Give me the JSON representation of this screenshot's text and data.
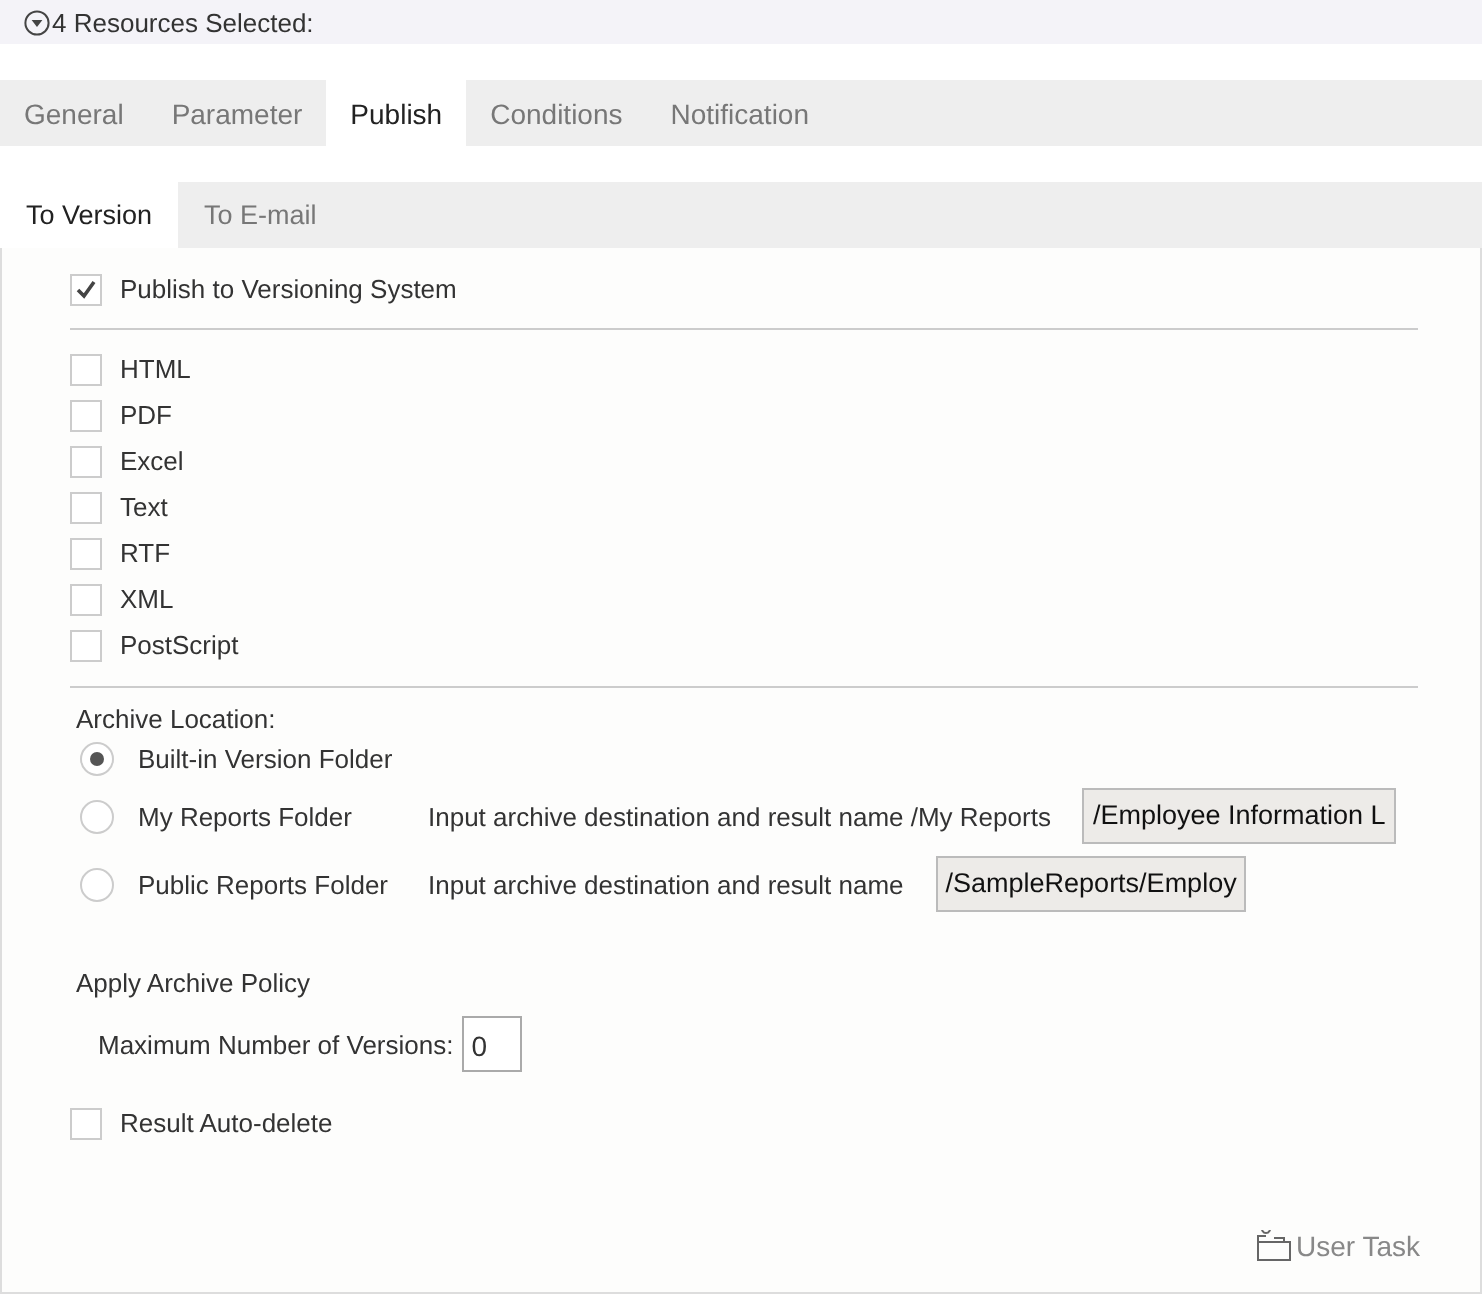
{
  "header": {
    "title": "4 Resources Selected:",
    "expanded": true
  },
  "tabs": [
    {
      "label": "General",
      "selected": false
    },
    {
      "label": "Parameter",
      "selected": false
    },
    {
      "label": "Publish",
      "selected": true
    },
    {
      "label": "Conditions",
      "selected": false
    },
    {
      "label": "Notification",
      "selected": false
    }
  ],
  "subtabs": [
    {
      "label": "To Version",
      "selected": true
    },
    {
      "label": "To E-mail",
      "selected": false
    }
  ],
  "publish_to_versioning": {
    "label": "Publish to Versioning System",
    "checked": true
  },
  "formats": [
    {
      "label": "HTML",
      "checked": false
    },
    {
      "label": "PDF",
      "checked": false
    },
    {
      "label": "Excel",
      "checked": false
    },
    {
      "label": "Text",
      "checked": false
    },
    {
      "label": "RTF",
      "checked": false
    },
    {
      "label": "XML",
      "checked": false
    },
    {
      "label": "PostScript",
      "checked": false
    }
  ],
  "archive_location": {
    "title": "Archive Location:",
    "options": [
      {
        "label": "Built-in Version Folder",
        "selected": true
      },
      {
        "label": "My Reports Folder",
        "selected": false,
        "hint": "Input archive destination and result name /My Reports",
        "value": "/Employee Information L"
      },
      {
        "label": "Public Reports Folder",
        "selected": false,
        "hint": "Input archive destination and result name",
        "value": "/SampleReports/Employ"
      }
    ]
  },
  "archive_policy": {
    "title": "Apply Archive Policy",
    "max_versions_label": "Maximum Number of Versions:",
    "max_versions": "0"
  },
  "auto_delete": {
    "label": "Result Auto-delete",
    "checked": false
  },
  "user_task": "User Task"
}
